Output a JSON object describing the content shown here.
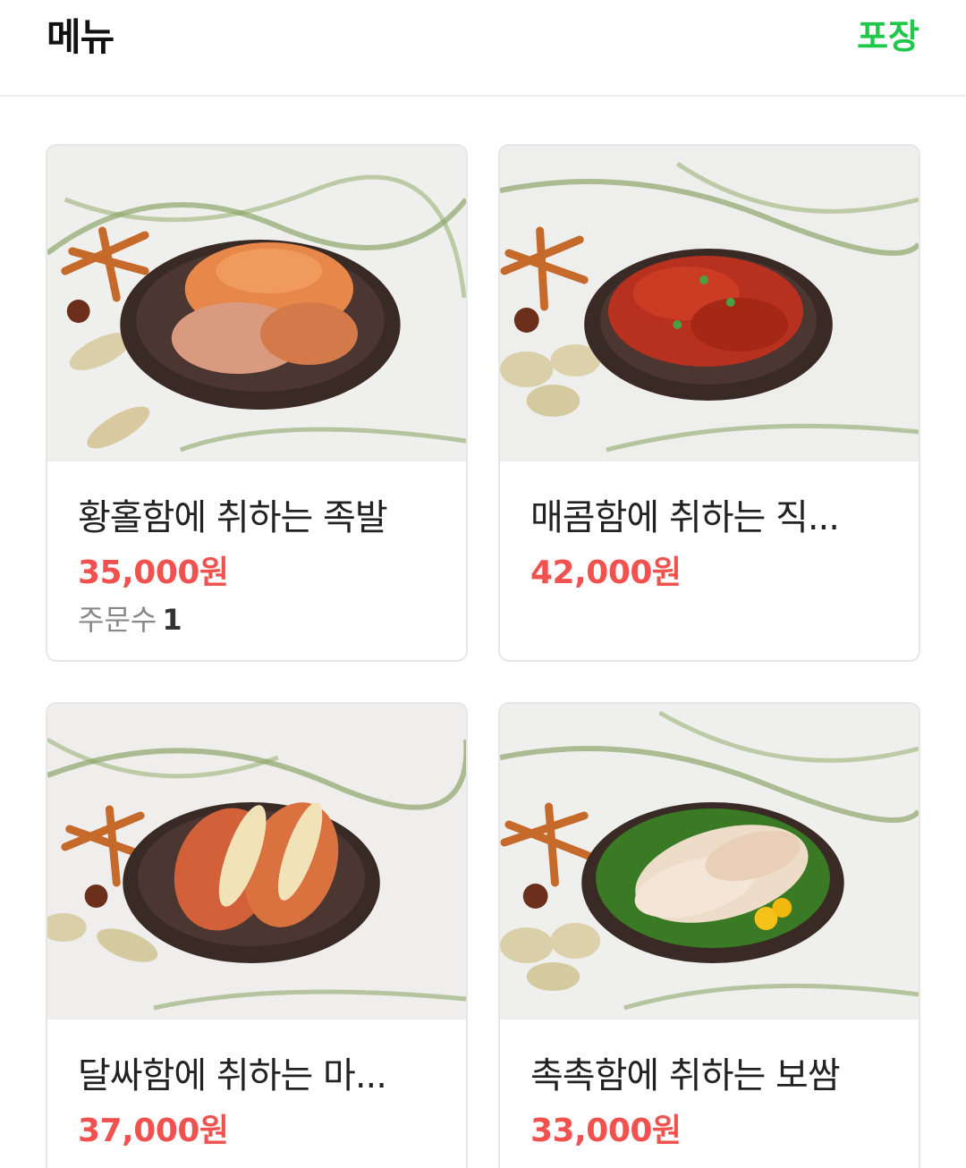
{
  "header": {
    "title": "메뉴",
    "tab_label": "포장",
    "accent_color": "#1fc74a"
  },
  "menu": {
    "items": [
      {
        "name": "황홀함에 취하는 족발",
        "price": "35,000원",
        "orders_label": "주문수",
        "orders_count": "1",
        "image": "braised-pork-trotters-photo"
      },
      {
        "name": "매콤함에 취하는 직...",
        "price": "42,000원",
        "image": "spicy-pork-photo"
      },
      {
        "name": "달싸함에 취하는 마...",
        "price": "37,000원",
        "image": "garlic-pork-trotters-photo"
      },
      {
        "name": "촉촉함에 취하는 보쌈",
        "price": "33,000원",
        "image": "bossam-photo"
      }
    ],
    "price_color": "#f0524f"
  }
}
